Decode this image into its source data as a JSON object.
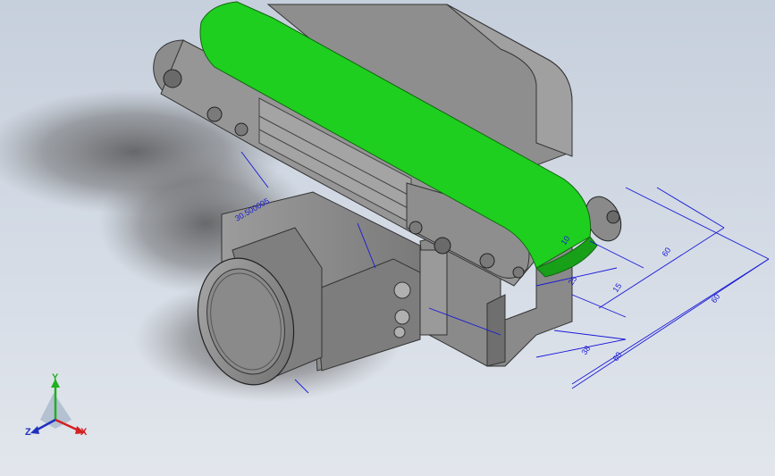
{
  "colors": {
    "background": "#cfd6e0",
    "belt": "#1fcf1f",
    "dimension": "#1a1ad6",
    "body": "#8c8c8c",
    "axis_x": "#d42020",
    "axis_y": "#20b020",
    "axis_z": "#2030c0"
  },
  "model": {
    "name": "belt-conveyor-assembly",
    "icon": "belt-conveyor-model"
  },
  "dimensions": {
    "d_60_top": "60",
    "d_60_right": "60",
    "d_60_bottom": "60",
    "d_38": "38",
    "d_15": "15",
    "d_25": "25",
    "d_30_500005": "30.500005",
    "d_10": "10"
  },
  "triad": {
    "x_label": "X",
    "y_label": "Y",
    "z_label": "Z"
  }
}
